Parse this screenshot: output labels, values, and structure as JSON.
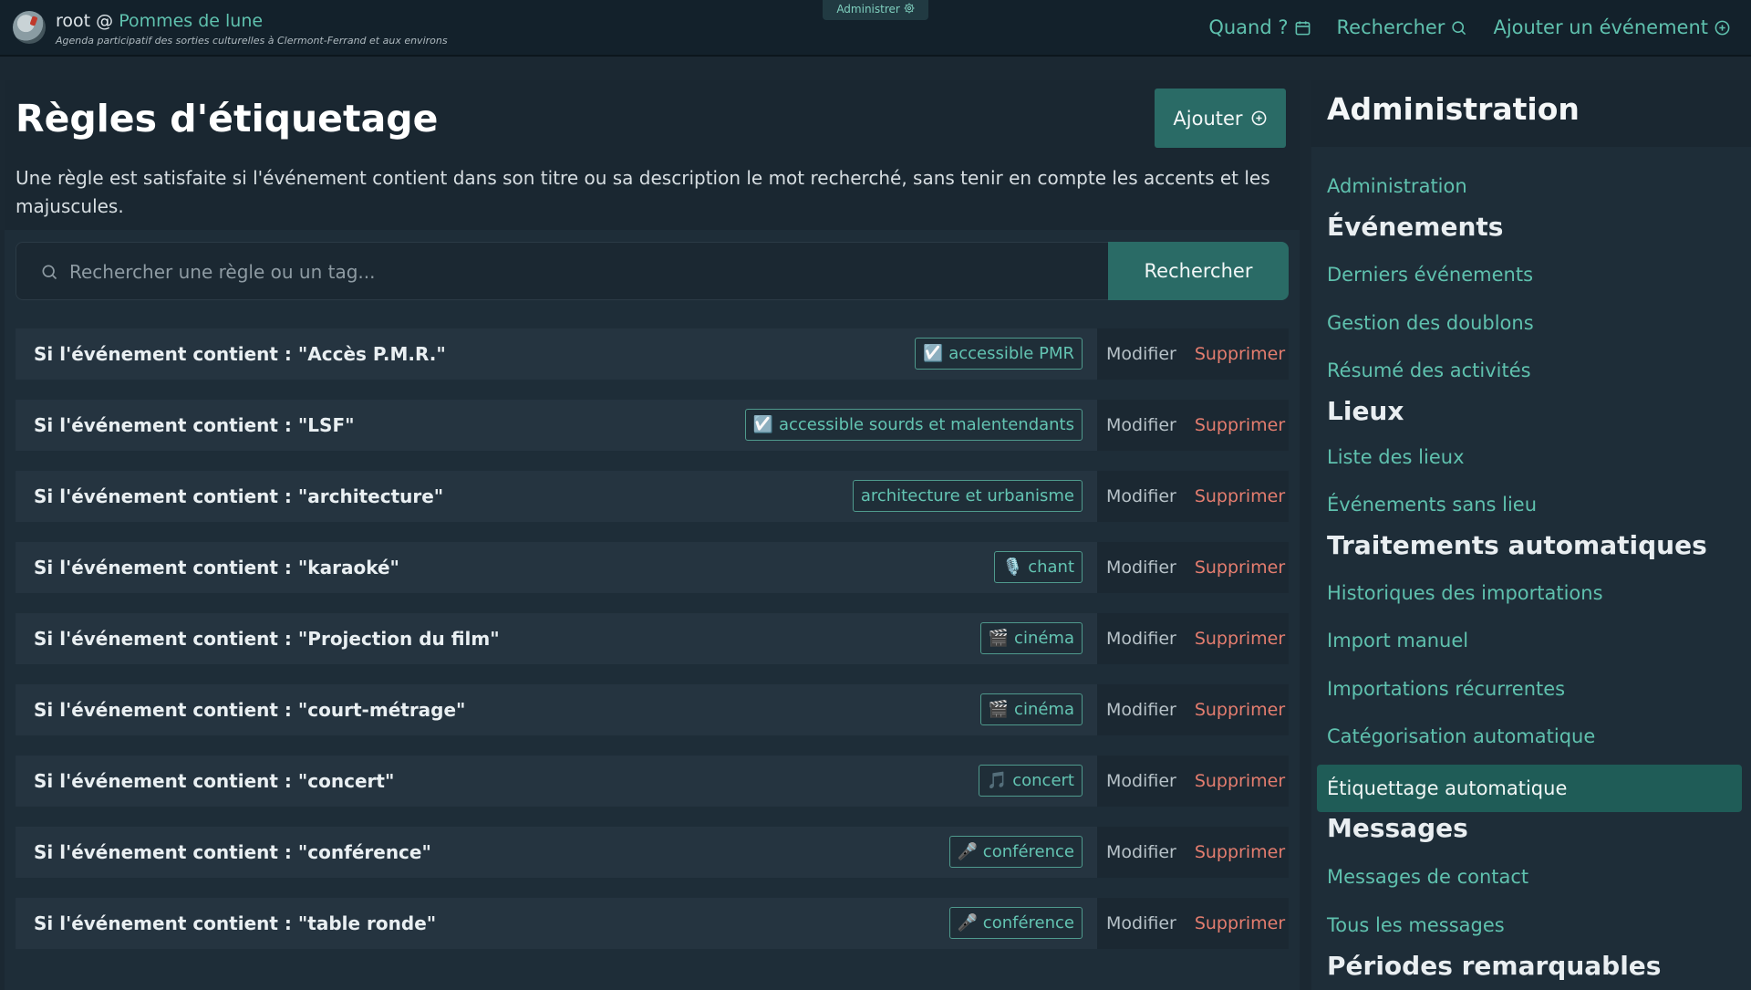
{
  "header": {
    "user": "root",
    "at": "@",
    "site_name": "Pommes de lune",
    "tagline": "Agenda participatif des sorties culturelles à Clermont-Ferrand et aux environs",
    "admin_pill": "Administrer",
    "nav": [
      {
        "label": "Quand ?",
        "icon": "calendar-icon"
      },
      {
        "label": "Rechercher",
        "icon": "search-icon"
      },
      {
        "label": "Ajouter un événement",
        "icon": "plus-circle-icon"
      }
    ]
  },
  "main": {
    "title": "Règles d'étiquetage",
    "add_label": "Ajouter",
    "intro": "Une règle est satisfaite si l'événement contient dans son titre ou sa description le mot recherché, sans tenir en compte les accents et les majuscules.",
    "search": {
      "placeholder": "Rechercher une règle ou un tag...",
      "value": "",
      "button": "Rechercher"
    },
    "actions": {
      "edit": "Modifier",
      "delete": "Supprimer"
    },
    "rules": [
      {
        "label": "Si l'événement contient : \"Accès P.M.R.\"",
        "tag": "☑️ accessible PMR"
      },
      {
        "label": "Si l'événement contient : \"LSF\"",
        "tag": "☑️ accessible sourds et malentendants"
      },
      {
        "label": "Si l'événement contient : \"architecture\"",
        "tag": "architecture et urbanisme"
      },
      {
        "label": "Si l'événement contient : \"karaoké\"",
        "tag": "🎙️ chant"
      },
      {
        "label": "Si l'événement contient : \"Projection du film\"",
        "tag": "🎬 cinéma"
      },
      {
        "label": "Si l'événement contient : \"court-métrage\"",
        "tag": "🎬 cinéma"
      },
      {
        "label": "Si l'événement contient : \"concert\"",
        "tag": "🎵 concert"
      },
      {
        "label": "Si l'événement contient : \"conférence\"",
        "tag": "🎤 conférence"
      },
      {
        "label": "Si l'événement contient : \"table ronde\"",
        "tag": "🎤 conférence"
      }
    ]
  },
  "sidebar": {
    "title": "Administration",
    "items": [
      {
        "kind": "link",
        "label": "Administration"
      },
      {
        "kind": "section",
        "label": "Événements"
      },
      {
        "kind": "link",
        "label": "Derniers événements"
      },
      {
        "kind": "link",
        "label": "Gestion des doublons"
      },
      {
        "kind": "link",
        "label": "Résumé des activités"
      },
      {
        "kind": "section",
        "label": "Lieux"
      },
      {
        "kind": "link",
        "label": "Liste des lieux"
      },
      {
        "kind": "link",
        "label": "Événements sans lieu"
      },
      {
        "kind": "section",
        "label": "Traitements automatiques"
      },
      {
        "kind": "link",
        "label": "Historiques des importations"
      },
      {
        "kind": "link",
        "label": "Import manuel"
      },
      {
        "kind": "link",
        "label": "Importations récurrentes"
      },
      {
        "kind": "link",
        "label": "Catégorisation automatique"
      },
      {
        "kind": "active",
        "label": "Étiquettage automatique"
      },
      {
        "kind": "section",
        "label": "Messages"
      },
      {
        "kind": "link",
        "label": "Messages de contact"
      },
      {
        "kind": "link",
        "label": "Tous les messages"
      },
      {
        "kind": "section",
        "label": "Périodes remarquables"
      }
    ]
  },
  "colors": {
    "accent": "#5fc1ae",
    "button": "#2a6b66",
    "danger": "#e47d6f",
    "background": "#1b2832"
  }
}
